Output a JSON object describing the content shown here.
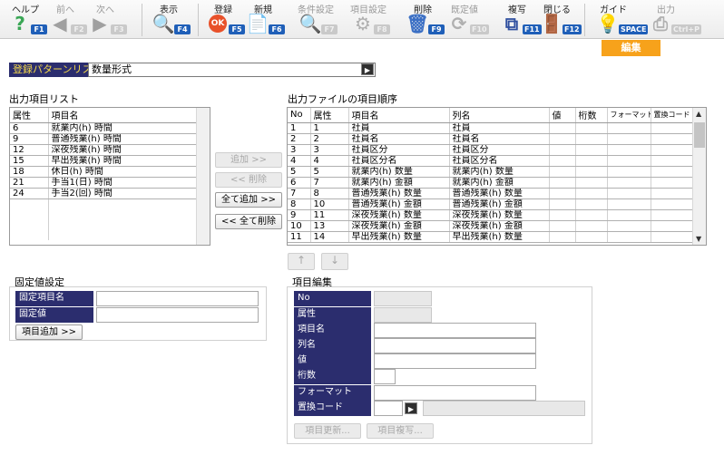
{
  "toolbar": {
    "buttons": [
      {
        "label": "ヘルプ",
        "key": "F1",
        "icon": "help-icon",
        "glyph": "?",
        "color": "#3aa655",
        "disabled": false
      },
      {
        "label": "前へ",
        "key": "F2",
        "icon": "arrow-left-icon",
        "glyph": "◀",
        "color": "#a0a0a0",
        "disabled": true
      },
      {
        "label": "次へ",
        "key": "F3",
        "icon": "arrow-right-icon",
        "glyph": "▶",
        "color": "#a0a0a0",
        "disabled": true
      },
      {
        "label": "表示",
        "key": "F4",
        "icon": "magnifier-icon",
        "glyph": "🔍",
        "color": "#3b6fc4",
        "disabled": false
      },
      {
        "label": "登録",
        "key": "F5",
        "icon": "ok-icon",
        "glyph": "OK",
        "color": "#e8512a",
        "disabled": false
      },
      {
        "label": "新規",
        "key": "F6",
        "icon": "new-document-icon",
        "glyph": "📄",
        "color": "#b08a3a",
        "disabled": false
      },
      {
        "label": "条件設定",
        "key": "F7",
        "icon": "condition-search-icon",
        "glyph": "🔍",
        "color": "#b0b0b0",
        "disabled": true
      },
      {
        "label": "項目設定",
        "key": "F8",
        "icon": "item-settings-icon",
        "glyph": "⚙",
        "color": "#b0b0b0",
        "disabled": true
      },
      {
        "label": "削除",
        "key": "F9",
        "icon": "trash-icon",
        "glyph": "🗑",
        "color": "#3b6fc4",
        "disabled": false
      },
      {
        "label": "既定値",
        "key": "F10",
        "icon": "default-value-icon",
        "glyph": "⟳",
        "color": "#b0b0b0",
        "disabled": true
      },
      {
        "label": "複写",
        "key": "F11",
        "icon": "copy-icon",
        "glyph": "⧉",
        "color": "#2f4f9f",
        "disabled": false
      },
      {
        "label": "閉じる",
        "key": "F12",
        "icon": "close-door-icon",
        "glyph": "🚪",
        "color": "#8b5a2b",
        "disabled": false
      },
      {
        "label": "ガイド",
        "key": "SPACE",
        "icon": "bulb-icon",
        "glyph": "💡",
        "color": "#e6b800",
        "disabled": false
      },
      {
        "label": "出力",
        "key": "Ctrl+P",
        "icon": "print-icon",
        "glyph": "⎙",
        "color": "#b0b0b0",
        "disabled": true
      }
    ]
  },
  "edit_tab": "編集",
  "pattern": {
    "label": "登録パターンリスト",
    "value": "数量形式",
    "dropdown_glyph": "▶"
  },
  "output_items": {
    "title": "出力項目リスト",
    "headers": [
      "属性",
      "項目名"
    ],
    "rows": [
      [
        "6",
        "就業内(h) 時間"
      ],
      [
        "9",
        "普通残業(h) 時間"
      ],
      [
        "12",
        "深夜残業(h) 時間"
      ],
      [
        "15",
        "早出残業(h) 時間"
      ],
      [
        "18",
        "休日(h) 時間"
      ],
      [
        "21",
        "手当1(日) 時間"
      ],
      [
        "24",
        "手当2(回) 時間"
      ]
    ]
  },
  "middle_buttons": {
    "add": "追加 >>",
    "remove": "<< 削除",
    "add_all": "全て追加 >>",
    "remove_all": "<< 全て削除"
  },
  "file_order": {
    "title": "出力ファイルの項目順序",
    "headers": [
      "No",
      "属性",
      "項目名",
      "列名",
      "値",
      "桁数",
      "フォーマット",
      "置換コード"
    ],
    "rows": [
      [
        "1",
        "1",
        "社員",
        "社員",
        "",
        "",
        "",
        ""
      ],
      [
        "2",
        "2",
        "社員名",
        "社員名",
        "",
        "",
        "",
        ""
      ],
      [
        "3",
        "3",
        "社員区分",
        "社員区分",
        "",
        "",
        "",
        ""
      ],
      [
        "4",
        "4",
        "社員区分名",
        "社員区分名",
        "",
        "",
        "",
        ""
      ],
      [
        "5",
        "5",
        "就業内(h) 数量",
        "就業内(h) 数量",
        "",
        "",
        "",
        ""
      ],
      [
        "6",
        "7",
        "就業内(h) 金額",
        "就業内(h) 金額",
        "",
        "",
        "",
        ""
      ],
      [
        "7",
        "8",
        "普通残業(h) 数量",
        "普通残業(h) 数量",
        "",
        "",
        "",
        ""
      ],
      [
        "8",
        "10",
        "普通残業(h) 金額",
        "普通残業(h) 金額",
        "",
        "",
        "",
        ""
      ],
      [
        "9",
        "11",
        "深夜残業(h) 数量",
        "深夜残業(h) 数量",
        "",
        "",
        "",
        ""
      ],
      [
        "10",
        "13",
        "深夜残業(h) 金額",
        "深夜残業(h) 金額",
        "",
        "",
        "",
        ""
      ],
      [
        "11",
        "14",
        "早出残業(h) 数量",
        "早出残業(h) 数量",
        "",
        "",
        "",
        ""
      ]
    ],
    "up_glyph": "↑",
    "down_glyph": "↓"
  },
  "fixed_value": {
    "title": "固定値設定",
    "item_name_label": "固定項目名",
    "value_label": "固定値",
    "item_name_value": "",
    "value_value": "",
    "add_button": "項目追加 >>"
  },
  "item_edit": {
    "title": "項目編集",
    "fields": [
      {
        "label": "No",
        "value": ""
      },
      {
        "label": "属性",
        "value": ""
      },
      {
        "label": "項目名",
        "value": ""
      },
      {
        "label": "列名",
        "value": ""
      },
      {
        "label": "値",
        "value": ""
      },
      {
        "label": "桁数",
        "value": ""
      },
      {
        "label": "フォーマット",
        "value": ""
      },
      {
        "label": "置換コード",
        "value": ""
      }
    ],
    "update_button": "項目更新...",
    "copy_button": "項目複写..."
  }
}
